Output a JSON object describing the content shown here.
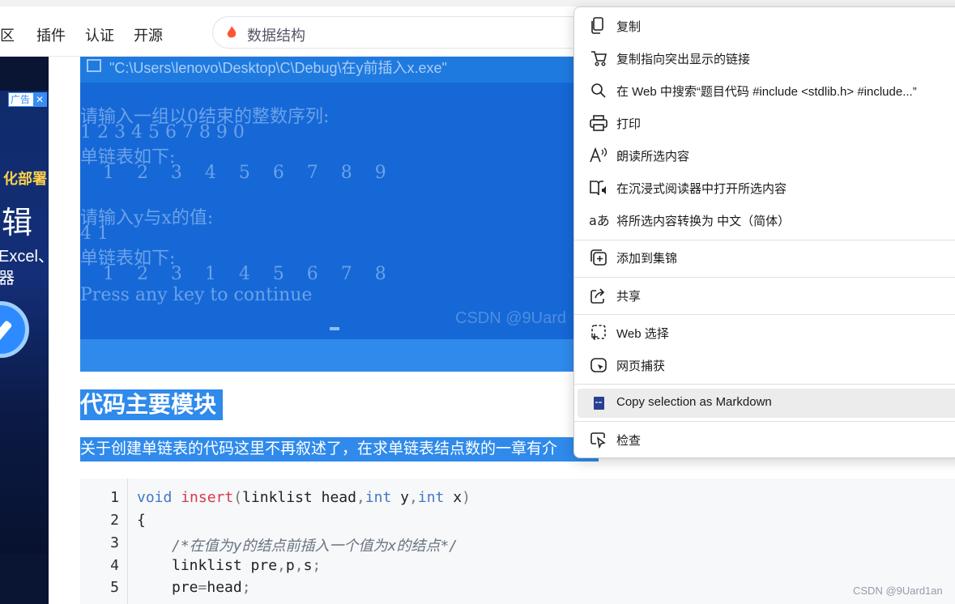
{
  "nav": {
    "items": [
      "区",
      "插件",
      "认证",
      "开源"
    ]
  },
  "search": {
    "query": "数据结构"
  },
  "ad": {
    "badge": "广告",
    "close": "✕",
    "line1": "化部署",
    "line2": "辑",
    "line3": "Excel、",
    "line4": "器"
  },
  "console": {
    "title": "\"C:\\Users\\lenovo\\Desktop\\C\\Debug\\在y前插入x.exe\"",
    "lines": [
      "请输入一组以0结束的整数序列:",
      "1 2 3 4 5 6 7 8 9 0",
      "单链表如下:",
      "    1    2    3    4    5    6    7    8    9",
      "",
      "请输入y与x的值:",
      "4 1",
      "单链表如下:",
      "    1    2    3    1    4    5    6    7    8",
      "Press any key to continue"
    ],
    "watermark": "CSDN @9Uard"
  },
  "article": {
    "heading": "代码主要模块",
    "para": "关于创建单链表的代码这里不再叙述了，在求单链表结点数的一章有介"
  },
  "code": {
    "line_numbers": [
      "1",
      "2",
      "3",
      "4",
      "5"
    ],
    "l1_kw": "void",
    "l1_fn": "insert",
    "l1_open": "(",
    "l1_a": "linklist head",
    "l1_c1": ",",
    "l1_int1": "int",
    "l1_y": " y",
    "l1_c2": ",",
    "l1_int2": "int",
    "l1_x": " x",
    "l1_close": ")",
    "l2": "{",
    "l3": "/*在值为y的结点前插入一个值为x的结点*/",
    "l4a": "linklist pre",
    "l4b": ",",
    "l4c": "p",
    "l4d": ",",
    "l4e": "s",
    "l4f": ";",
    "l5a": "pre",
    "l5b": "=",
    "l5c": "head",
    "l5d": ";"
  },
  "footer": {
    "watermark": "CSDN @9Uard1an"
  },
  "menu": {
    "items": [
      {
        "label": "复制",
        "icon": "copy-icon"
      },
      {
        "label": "复制指向突出显示的链接",
        "icon": "link-highlight-icon"
      },
      {
        "label": "在 Web 中搜索“题目代码 #include <stdlib.h> #include...”",
        "icon": "search-icon"
      },
      {
        "label": "打印",
        "icon": "print-icon"
      },
      {
        "label": "朗读所选内容",
        "icon": "read-aloud-icon"
      },
      {
        "label": "在沉浸式阅读器中打开所选内容",
        "icon": "immersive-reader-icon"
      },
      {
        "label": "将所选内容转换为 中文（简体）",
        "icon": "translate-icon"
      },
      {
        "label": "添加到集锦",
        "icon": "collections-icon"
      },
      {
        "label": "共享",
        "icon": "share-icon"
      },
      {
        "label": "Web 选择",
        "icon": "web-select-icon"
      },
      {
        "label": "网页捕获",
        "icon": "web-capture-icon"
      },
      {
        "label": "Copy selection as Markdown",
        "icon": "markdown-extension-icon"
      },
      {
        "label": "检查",
        "icon": "inspect-icon"
      }
    ],
    "highlighted_index": 11
  }
}
